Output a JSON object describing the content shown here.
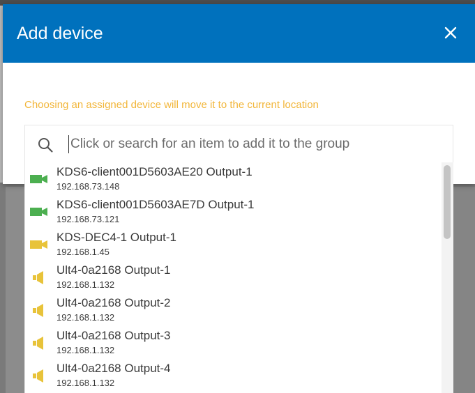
{
  "modal": {
    "title": "Add device",
    "close_icon": "close-icon",
    "warning": "Choosing an assigned device will move it to the current location"
  },
  "search": {
    "icon": "search-icon",
    "placeholder": "Click or search for an item to add it to the group",
    "value": ""
  },
  "colors": {
    "header": "#0071bd",
    "warning": "#f2b63a",
    "camera_green": "#4caf50",
    "camera_yellow": "#e8c33a",
    "speaker_yellow": "#e8c33a"
  },
  "devices": [
    {
      "name": "KDS6-client001D5603AE20 Output-1",
      "ip": "192.168.73.148",
      "icon": "video-camera-icon",
      "color": "green"
    },
    {
      "name": "KDS6-client001D5603AE7D Output-1",
      "ip": "192.168.73.121",
      "icon": "video-camera-icon",
      "color": "green"
    },
    {
      "name": "KDS-DEC4-1 Output-1",
      "ip": "192.168.1.45",
      "icon": "video-camera-icon",
      "color": "yellow"
    },
    {
      "name": "Ult4-0a2168 Output-1",
      "ip": "192.168.1.132",
      "icon": "speaker-icon",
      "color": "yellow"
    },
    {
      "name": "Ult4-0a2168 Output-2",
      "ip": "192.168.1.132",
      "icon": "speaker-icon",
      "color": "yellow"
    },
    {
      "name": "Ult4-0a2168 Output-3",
      "ip": "192.168.1.132",
      "icon": "speaker-icon",
      "color": "yellow"
    },
    {
      "name": "Ult4-0a2168 Output-4",
      "ip": "192.168.1.132",
      "icon": "speaker-icon",
      "color": "yellow"
    }
  ]
}
